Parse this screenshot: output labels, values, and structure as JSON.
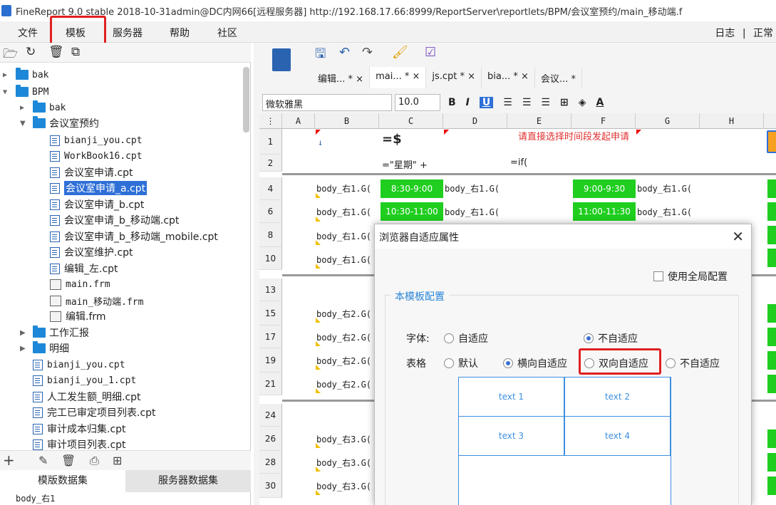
{
  "window": {
    "title": "FineReport 9.0 stable 2018-10-31admin@DC内网66[远程服务器]    http://192.168.17.66:8999/ReportServer\\reportlets/BPM/会议室预约/main_移动端.f"
  },
  "menu": {
    "file": "文件",
    "template": "模板",
    "server": "服务器",
    "help": "帮助",
    "community": "社区",
    "log": "日志",
    "status": "正常"
  },
  "tree": {
    "items": [
      "bak",
      "BPM",
      "bak",
      "会议室预约",
      "bianji_you.cpt",
      "WorkBook16.cpt",
      "会议室申请.cpt",
      "会议室申请_a.cpt",
      "会议室申请_b.cpt",
      "会议室申请_b_移动端.cpt",
      "会议室申请_b_移动端_mobile.cpt",
      "会议室维护.cpt",
      "编辑_左.cpt",
      "main.frm",
      "main_移动端.frm",
      "编辑.frm",
      "工作汇报",
      "明细",
      "bianji_you.cpt",
      "bianji_you_1.cpt",
      "人工发生额_明细.cpt",
      "完工已审定项目列表.cpt",
      "审计成本归集.cpt",
      "审计项目列表.cpt"
    ],
    "selected": "会议室申请_a.cpt"
  },
  "bottom_tabs": {
    "template_ds": "模版数据集",
    "server_ds": "服务器数据集"
  },
  "ds_item": "body_右1",
  "editor_tabs": [
    "编辑... * ×",
    "mai... * ×",
    "js.cpt * ×",
    "bia... * ×",
    "会议... *"
  ],
  "format": {
    "font": "微软雅黑",
    "size": "10.0",
    "bold": "B",
    "italic": "I",
    "underline": "U"
  },
  "grid": {
    "columns": [
      "A",
      "B",
      "C",
      "D",
      "E",
      "F",
      "G",
      "H"
    ],
    "rows": [
      "1",
      "2",
      "4",
      "6",
      "8",
      "10",
      "13",
      "15",
      "17",
      "19",
      "21",
      "24",
      "26",
      "28",
      "30"
    ],
    "c1": "=$",
    "c2": "=\"星期\" +",
    "e2": "=if(",
    "e1": "请直接选择时间段发起申请",
    "body1": "body_右1.G(",
    "body2": "body_右2.G(",
    "body3": "body_右3.G(",
    "t1": "8:30-9:00",
    "t2": "9:00-9:30",
    "t3": "10:30-11:00",
    "t4": "11:00-11:30"
  },
  "dialog": {
    "title": "浏览器自适应属性",
    "use_global": "使用全局配置",
    "group": "本模板配置",
    "font_label": "字体:",
    "font_adaptive": "自适应",
    "font_not_adaptive": "不自适应",
    "table_label": "表格",
    "table_default": "默认",
    "table_horizontal": "横向自适应",
    "table_both": "双向自适应",
    "table_none": "不自适应",
    "preview": [
      "text 1",
      "text 2",
      "text 3",
      "text 4"
    ]
  },
  "colors": {
    "highlight": "#e02020",
    "green": "#1fce1f",
    "selection": "#2e6fd8",
    "group_label": "#2a86d8"
  }
}
